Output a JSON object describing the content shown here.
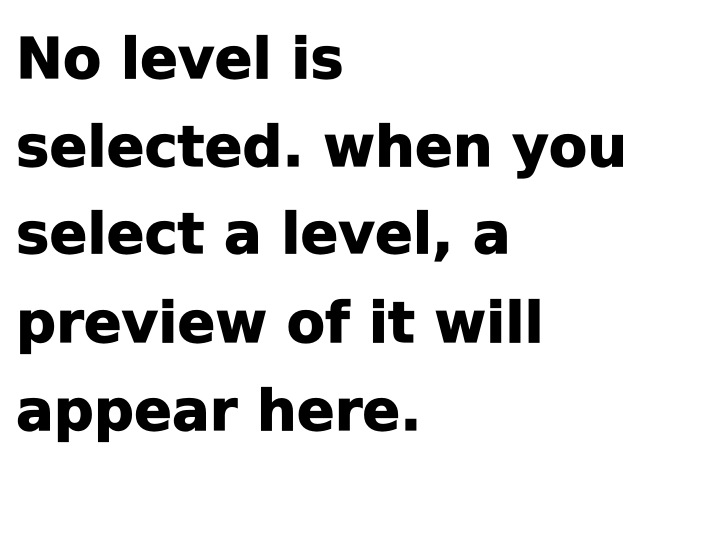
{
  "preview": {
    "message_lines": [
      "No level is",
      "selected. when you",
      "select a level, a",
      "preview of it will",
      "appear here."
    ]
  },
  "colors": {
    "background": "#ffffff",
    "text": "#000000"
  }
}
